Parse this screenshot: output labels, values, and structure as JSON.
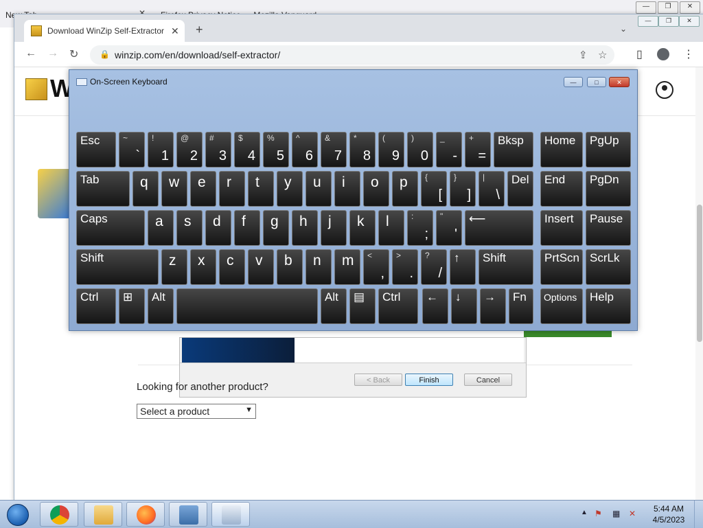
{
  "background_window": {
    "tab1_title": "New Tab",
    "tab2_title": "Firefox Privacy Notice — Mozilla Vanguard"
  },
  "chrome": {
    "tab_title": "Download WinZip Self-Extractor",
    "url": "winzip.com/en/download/self-extractor/",
    "page": {
      "logo_text": "W",
      "looking_label": "Looking for another product?",
      "select_value": "Select a product"
    },
    "setup_dialog": {
      "back_label": "< Back",
      "finish_label": "Finish",
      "cancel_label": "Cancel"
    }
  },
  "osk": {
    "title": "On-Screen Keyboard",
    "rows": [
      [
        {
          "id": "esc",
          "label": "Esc"
        },
        {
          "id": "backtick",
          "top": "~",
          "main": "`"
        },
        {
          "id": "1",
          "top": "!",
          "main": "1"
        },
        {
          "id": "2",
          "top": "@",
          "main": "2"
        },
        {
          "id": "3",
          "top": "#",
          "main": "3"
        },
        {
          "id": "4",
          "top": "$",
          "main": "4"
        },
        {
          "id": "5",
          "top": "%",
          "main": "5"
        },
        {
          "id": "6",
          "top": "^",
          "main": "6"
        },
        {
          "id": "7",
          "top": "&",
          "main": "7"
        },
        {
          "id": "8",
          "top": "*",
          "main": "8"
        },
        {
          "id": "9",
          "top": "(",
          "main": "9"
        },
        {
          "id": "0",
          "top": ")",
          "main": "0"
        },
        {
          "id": "minus",
          "top": "_",
          "main": "-"
        },
        {
          "id": "equals",
          "top": "+",
          "main": "="
        },
        {
          "id": "bksp",
          "label": "Bksp"
        },
        {
          "id": "home",
          "label": "Home"
        },
        {
          "id": "pgup",
          "label": "PgUp"
        }
      ],
      [
        {
          "id": "tab",
          "label": "Tab"
        },
        {
          "id": "q",
          "ch": "q"
        },
        {
          "id": "w",
          "ch": "w"
        },
        {
          "id": "e",
          "ch": "e"
        },
        {
          "id": "r",
          "ch": "r"
        },
        {
          "id": "t",
          "ch": "t"
        },
        {
          "id": "y",
          "ch": "y"
        },
        {
          "id": "u",
          "ch": "u"
        },
        {
          "id": "i",
          "ch": "i"
        },
        {
          "id": "o",
          "ch": "o"
        },
        {
          "id": "p",
          "ch": "p"
        },
        {
          "id": "lbracket",
          "top": "{",
          "main": "["
        },
        {
          "id": "rbracket",
          "top": "}",
          "main": "]"
        },
        {
          "id": "backslash",
          "top": "|",
          "main": "\\"
        },
        {
          "id": "del",
          "label": "Del"
        },
        {
          "id": "end",
          "label": "End"
        },
        {
          "id": "pgdn",
          "label": "PgDn"
        }
      ],
      [
        {
          "id": "caps",
          "label": "Caps"
        },
        {
          "id": "a",
          "ch": "a"
        },
        {
          "id": "s",
          "ch": "s"
        },
        {
          "id": "d",
          "ch": "d"
        },
        {
          "id": "f",
          "ch": "f"
        },
        {
          "id": "g",
          "ch": "g"
        },
        {
          "id": "h",
          "ch": "h"
        },
        {
          "id": "j",
          "ch": "j"
        },
        {
          "id": "k",
          "ch": "k"
        },
        {
          "id": "l",
          "ch": "l"
        },
        {
          "id": "semicolon",
          "top": ":",
          "main": ";"
        },
        {
          "id": "quote",
          "top": "\"",
          "main": "'"
        },
        {
          "id": "enter",
          "label": "⟵"
        },
        {
          "id": "insert",
          "label": "Insert"
        },
        {
          "id": "pause",
          "label": "Pause"
        }
      ],
      [
        {
          "id": "lshift",
          "label": "Shift"
        },
        {
          "id": "z",
          "ch": "z"
        },
        {
          "id": "x",
          "ch": "x"
        },
        {
          "id": "c",
          "ch": "c"
        },
        {
          "id": "v",
          "ch": "v"
        },
        {
          "id": "b",
          "ch": "b"
        },
        {
          "id": "n",
          "ch": "n"
        },
        {
          "id": "m",
          "ch": "m"
        },
        {
          "id": "comma",
          "top": "<",
          "main": ","
        },
        {
          "id": "period",
          "top": ">",
          "main": "."
        },
        {
          "id": "slash",
          "top": "?",
          "main": "/"
        },
        {
          "id": "up",
          "label": "↑"
        },
        {
          "id": "rshift",
          "label": "Shift"
        },
        {
          "id": "prtscn",
          "label": "PrtScn"
        },
        {
          "id": "scrlk",
          "label": "ScrLk"
        }
      ],
      [
        {
          "id": "lctrl",
          "label": "Ctrl"
        },
        {
          "id": "win",
          "label": "⊞"
        },
        {
          "id": "lalt",
          "label": "Alt"
        },
        {
          "id": "space",
          "label": ""
        },
        {
          "id": "ralt",
          "label": "Alt"
        },
        {
          "id": "menu",
          "label": "▤"
        },
        {
          "id": "rctrl",
          "label": "Ctrl"
        },
        {
          "id": "left",
          "label": "←"
        },
        {
          "id": "down",
          "label": "↓"
        },
        {
          "id": "right",
          "label": "→"
        },
        {
          "id": "fn",
          "label": "Fn"
        },
        {
          "id": "options",
          "label": "Options",
          "small": true
        },
        {
          "id": "help",
          "label": "Help"
        }
      ]
    ]
  },
  "taskbar": {
    "time": "5:44 AM",
    "date": "4/5/2023",
    "apps": [
      "chrome-icon",
      "file-explorer-icon",
      "firefox-icon",
      "network-setup-icon",
      "on-screen-keyboard-icon"
    ]
  },
  "colors": {
    "osk_frame": "#a7c1e3",
    "key_bg": "#1e1e1e",
    "close_red": "#c1392b",
    "taskbar": "#b6cbe4"
  }
}
